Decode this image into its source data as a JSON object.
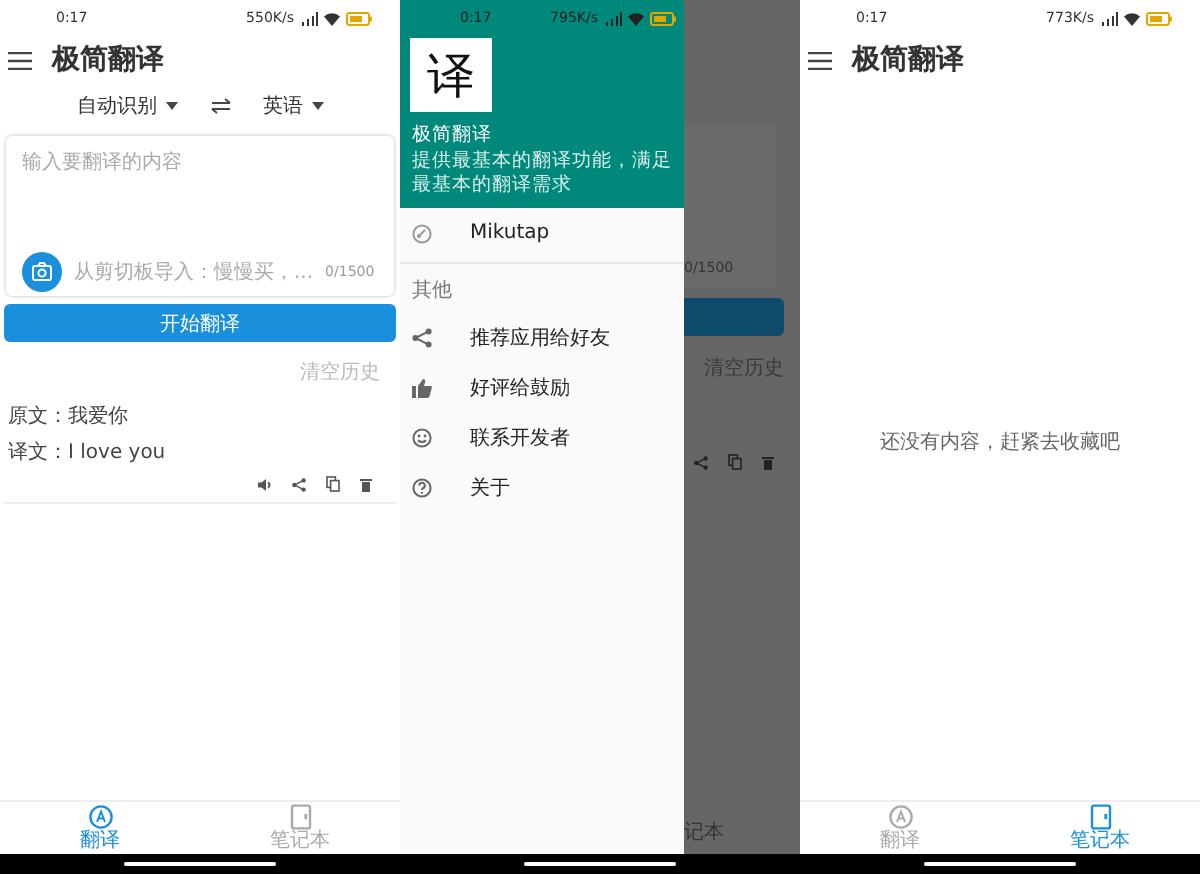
{
  "screens": [
    {
      "kind": "translate",
      "status_bar": {
        "time": "0:17",
        "speed": "550K/s"
      },
      "app_bar": {
        "title": "极简翻译"
      },
      "languages": {
        "source": "自动识别",
        "target": "英语"
      },
      "input": {
        "placeholder": "输入要翻译的内容",
        "clipboard_hint": "从剪切板导入：慢慢买，...",
        "counter": "0/1500"
      },
      "translate_button": "开始翻译",
      "clear_history": "清空历史",
      "history": [
        {
          "source": "原文：我爱你",
          "target": "译文：I love you"
        }
      ],
      "tabs": [
        {
          "label": "翻译",
          "selected": true
        },
        {
          "label": "笔记本",
          "selected": false
        }
      ]
    },
    {
      "kind": "drawer",
      "status_bar": {
        "time": "0:17",
        "speed": "795K/s"
      },
      "drawer": {
        "logo": "译",
        "app_name": "极简翻译",
        "description": "提供最基本的翻译功能，满足最基本的翻译需求",
        "items": [
          {
            "label": "Mikutap"
          }
        ],
        "section_title": "其他",
        "section_items": [
          {
            "label": "推荐应用给好友"
          },
          {
            "label": "好评给鼓励"
          },
          {
            "label": "联系开发者"
          },
          {
            "label": "关于"
          }
        ]
      },
      "background": {
        "counter": "0/1500",
        "clear_history": "清空历史",
        "tab_label": "记本"
      }
    },
    {
      "kind": "notebook",
      "status_bar": {
        "time": "0:17",
        "speed": "773K/s"
      },
      "app_bar": {
        "title": "极简翻译"
      },
      "empty_message": "还没有内容，赶紧去收藏吧",
      "tabs": [
        {
          "label": "翻译",
          "selected": false
        },
        {
          "label": "笔记本",
          "selected": true
        }
      ]
    }
  ]
}
